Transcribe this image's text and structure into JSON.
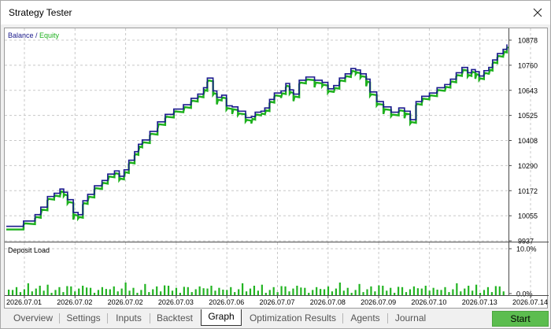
{
  "window": {
    "title": "Strategy Tester"
  },
  "chart": {
    "legend_balance": "Balance",
    "legend_sep": " / ",
    "legend_equity": "Equity",
    "deposit_title": "Deposit Load"
  },
  "tabs": [
    {
      "label": "Overview",
      "active": false
    },
    {
      "label": "Settings",
      "active": false
    },
    {
      "label": "Inputs",
      "active": false
    },
    {
      "label": "Backtest",
      "active": false
    },
    {
      "label": "Graph",
      "active": true
    },
    {
      "label": "Optimization Results",
      "active": false
    },
    {
      "label": "Agents",
      "active": false
    },
    {
      "label": "Journal",
      "active": false
    }
  ],
  "start_label": "Start",
  "colors": {
    "balance": "#1a1a8c",
    "equity": "#1db01d",
    "deposit_bar": "#22b422",
    "start_button": "#5cbd4f"
  },
  "chart_data": [
    {
      "type": "line",
      "series": [
        {
          "name": "Balance"
        },
        {
          "name": "Equity"
        }
      ],
      "y_ticks": [
        "10878",
        "10760",
        "10643",
        "10525",
        "10408",
        "10290",
        "10172",
        "10055",
        "9937"
      ],
      "ylim": [
        9937,
        10878
      ],
      "x_ticks": [
        "2026.07.01",
        "2026.07.02",
        "2026.07.02",
        "2026.07.03",
        "2026.07.06",
        "2026.07.07",
        "2026.07.08",
        "2026.07.09",
        "2026.07.10",
        "2026.07.13",
        "2026.07.14"
      ],
      "grid": true,
      "legend": "top-left",
      "points": [
        [
          0,
          10005
        ],
        [
          1.8,
          10030
        ],
        [
          3.0,
          10060
        ],
        [
          3.6,
          10095
        ],
        [
          4.3,
          10145
        ],
        [
          5.0,
          10160
        ],
        [
          5.6,
          10180
        ],
        [
          6.0,
          10165
        ],
        [
          6.4,
          10130
        ],
        [
          7.0,
          10070
        ],
        [
          7.5,
          10060
        ],
        [
          8.0,
          10125
        ],
        [
          8.5,
          10155
        ],
        [
          9.2,
          10195
        ],
        [
          10.0,
          10220
        ],
        [
          10.6,
          10250
        ],
        [
          11.3,
          10265
        ],
        [
          11.8,
          10240
        ],
        [
          12.3,
          10270
        ],
        [
          12.8,
          10315
        ],
        [
          13.4,
          10355
        ],
        [
          13.8,
          10390
        ],
        [
          14.2,
          10410
        ],
        [
          15.0,
          10450
        ],
        [
          15.8,
          10495
        ],
        [
          16.6,
          10530
        ],
        [
          17.5,
          10555
        ],
        [
          18.5,
          10575
        ],
        [
          19.3,
          10605
        ],
        [
          20.0,
          10625
        ],
        [
          20.6,
          10655
        ],
        [
          21.0,
          10700
        ],
        [
          21.6,
          10640
        ],
        [
          22.0,
          10610
        ],
        [
          22.5,
          10620
        ],
        [
          23.0,
          10570
        ],
        [
          23.6,
          10565
        ],
        [
          24.2,
          10545
        ],
        [
          25.0,
          10515
        ],
        [
          25.6,
          10520
        ],
        [
          26.0,
          10540
        ],
        [
          26.6,
          10545
        ],
        [
          27.0,
          10560
        ],
        [
          27.5,
          10600
        ],
        [
          28.0,
          10630
        ],
        [
          28.7,
          10640
        ],
        [
          29.2,
          10675
        ],
        [
          29.6,
          10645
        ],
        [
          30.0,
          10625
        ],
        [
          30.6,
          10690
        ],
        [
          31.3,
          10705
        ],
        [
          32.2,
          10690
        ],
        [
          33.0,
          10680
        ],
        [
          33.6,
          10650
        ],
        [
          34.2,
          10665
        ],
        [
          34.8,
          10700
        ],
        [
          35.4,
          10720
        ],
        [
          36.0,
          10745
        ],
        [
          36.5,
          10738
        ],
        [
          37.0,
          10720
        ],
        [
          37.6,
          10695
        ],
        [
          38.0,
          10635
        ],
        [
          38.7,
          10590
        ],
        [
          39.4,
          10565
        ],
        [
          40.2,
          10540
        ],
        [
          41.0,
          10560
        ],
        [
          41.6,
          10545
        ],
        [
          42.2,
          10505
        ],
        [
          42.8,
          10590
        ],
        [
          43.4,
          10615
        ],
        [
          44.2,
          10630
        ],
        [
          45.0,
          10655
        ],
        [
          45.8,
          10670
        ],
        [
          46.4,
          10695
        ],
        [
          47.0,
          10725
        ],
        [
          47.6,
          10750
        ],
        [
          48.2,
          10725
        ],
        [
          48.6,
          10740
        ],
        [
          49.0,
          10730
        ],
        [
          49.4,
          10710
        ],
        [
          49.9,
          10735
        ],
        [
          50.4,
          10750
        ],
        [
          50.8,
          10785
        ],
        [
          51.3,
          10815
        ],
        [
          51.9,
          10835
        ],
        [
          52.3,
          10858
        ]
      ]
    },
    {
      "type": "bar",
      "title": "Deposit Load",
      "y_ticks": [
        "10.0%",
        "0.0%"
      ],
      "ylim": [
        0,
        10
      ]
    }
  ]
}
